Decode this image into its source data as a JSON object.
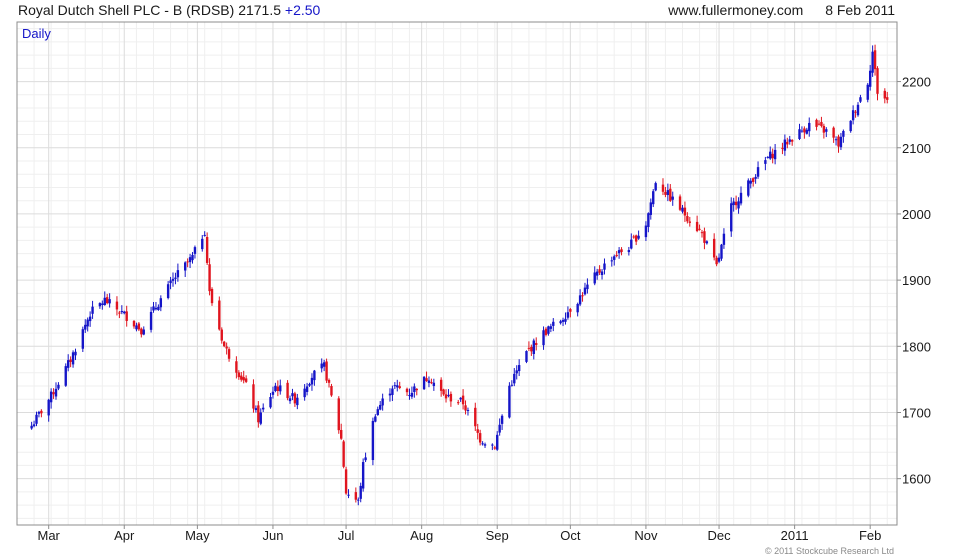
{
  "header": {
    "security": "Royal Dutch Shell PLC - B (RDSB)",
    "last": "2171.5",
    "change": "+2.50",
    "site": "www.fullermoney.com",
    "date": "8 Feb 2011"
  },
  "colors": {
    "up": "#1515c8",
    "down": "#e0141e",
    "grid": "#dcdcdc",
    "frame": "#8c8c8c"
  },
  "footer": {
    "copyright": "© 2011 Stockcube Research Ltd"
  },
  "chart_data": {
    "type": "candlestick",
    "period_label": "Daily",
    "x_ticks": [
      "Mar",
      "Apr",
      "May",
      "Jun",
      "Jul",
      "Aug",
      "Sep",
      "Oct",
      "Nov",
      "Dec",
      "2011",
      "Feb"
    ],
    "y_ticks": [
      1600,
      1700,
      1800,
      1900,
      2000,
      2100,
      2200
    ],
    "ylim": [
      1530,
      2290
    ],
    "y_axis_side": "right",
    "grid": true,
    "anchors": [
      [
        "2010-02-22",
        1680
      ],
      [
        "2010-03-02",
        1725
      ],
      [
        "2010-03-10",
        1780
      ],
      [
        "2010-03-18",
        1850
      ],
      [
        "2010-03-24",
        1870
      ],
      [
        "2010-04-02",
        1845
      ],
      [
        "2010-04-08",
        1825
      ],
      [
        "2010-04-14",
        1860
      ],
      [
        "2010-04-22",
        1905
      ],
      [
        "2010-04-29",
        1935
      ],
      [
        "2010-05-04",
        1975
      ],
      [
        "2010-05-06",
        1880
      ],
      [
        "2010-05-12",
        1800
      ],
      [
        "2010-05-21",
        1740
      ],
      [
        "2010-05-26",
        1690
      ],
      [
        "2010-06-02",
        1740
      ],
      [
        "2010-06-10",
        1720
      ],
      [
        "2010-06-17",
        1755
      ],
      [
        "2010-06-22",
        1770
      ],
      [
        "2010-06-29",
        1660
      ],
      [
        "2010-07-01",
        1580
      ],
      [
        "2010-07-06",
        1565
      ],
      [
        "2010-07-08",
        1620
      ],
      [
        "2010-07-13",
        1700
      ],
      [
        "2010-07-20",
        1740
      ],
      [
        "2010-07-27",
        1730
      ],
      [
        "2010-08-04",
        1755
      ],
      [
        "2010-08-10",
        1725
      ],
      [
        "2010-08-18",
        1715
      ],
      [
        "2010-08-25",
        1660
      ],
      [
        "2010-08-31",
        1650
      ],
      [
        "2010-09-06",
        1740
      ],
      [
        "2010-09-13",
        1790
      ],
      [
        "2010-09-20",
        1820
      ],
      [
        "2010-09-27",
        1840
      ],
      [
        "2010-10-04",
        1870
      ],
      [
        "2010-10-11",
        1905
      ],
      [
        "2010-10-18",
        1935
      ],
      [
        "2010-10-25",
        1950
      ],
      [
        "2010-11-01",
        1985
      ],
      [
        "2010-11-05",
        2050
      ],
      [
        "2010-11-11",
        2025
      ],
      [
        "2010-11-17",
        2000
      ],
      [
        "2010-11-24",
        1970
      ],
      [
        "2010-11-30",
        1920
      ],
      [
        "2010-12-06",
        2010
      ],
      [
        "2010-12-14",
        2050
      ],
      [
        "2010-12-21",
        2085
      ],
      [
        "2010-12-31",
        2115
      ],
      [
        "2011-01-07",
        2135
      ],
      [
        "2011-01-14",
        2125
      ],
      [
        "2011-01-19",
        2105
      ],
      [
        "2011-01-26",
        2160
      ],
      [
        "2011-01-31",
        2200
      ],
      [
        "2011-02-02",
        2245
      ],
      [
        "2011-02-04",
        2185
      ],
      [
        "2011-02-08",
        2171.5
      ]
    ]
  }
}
